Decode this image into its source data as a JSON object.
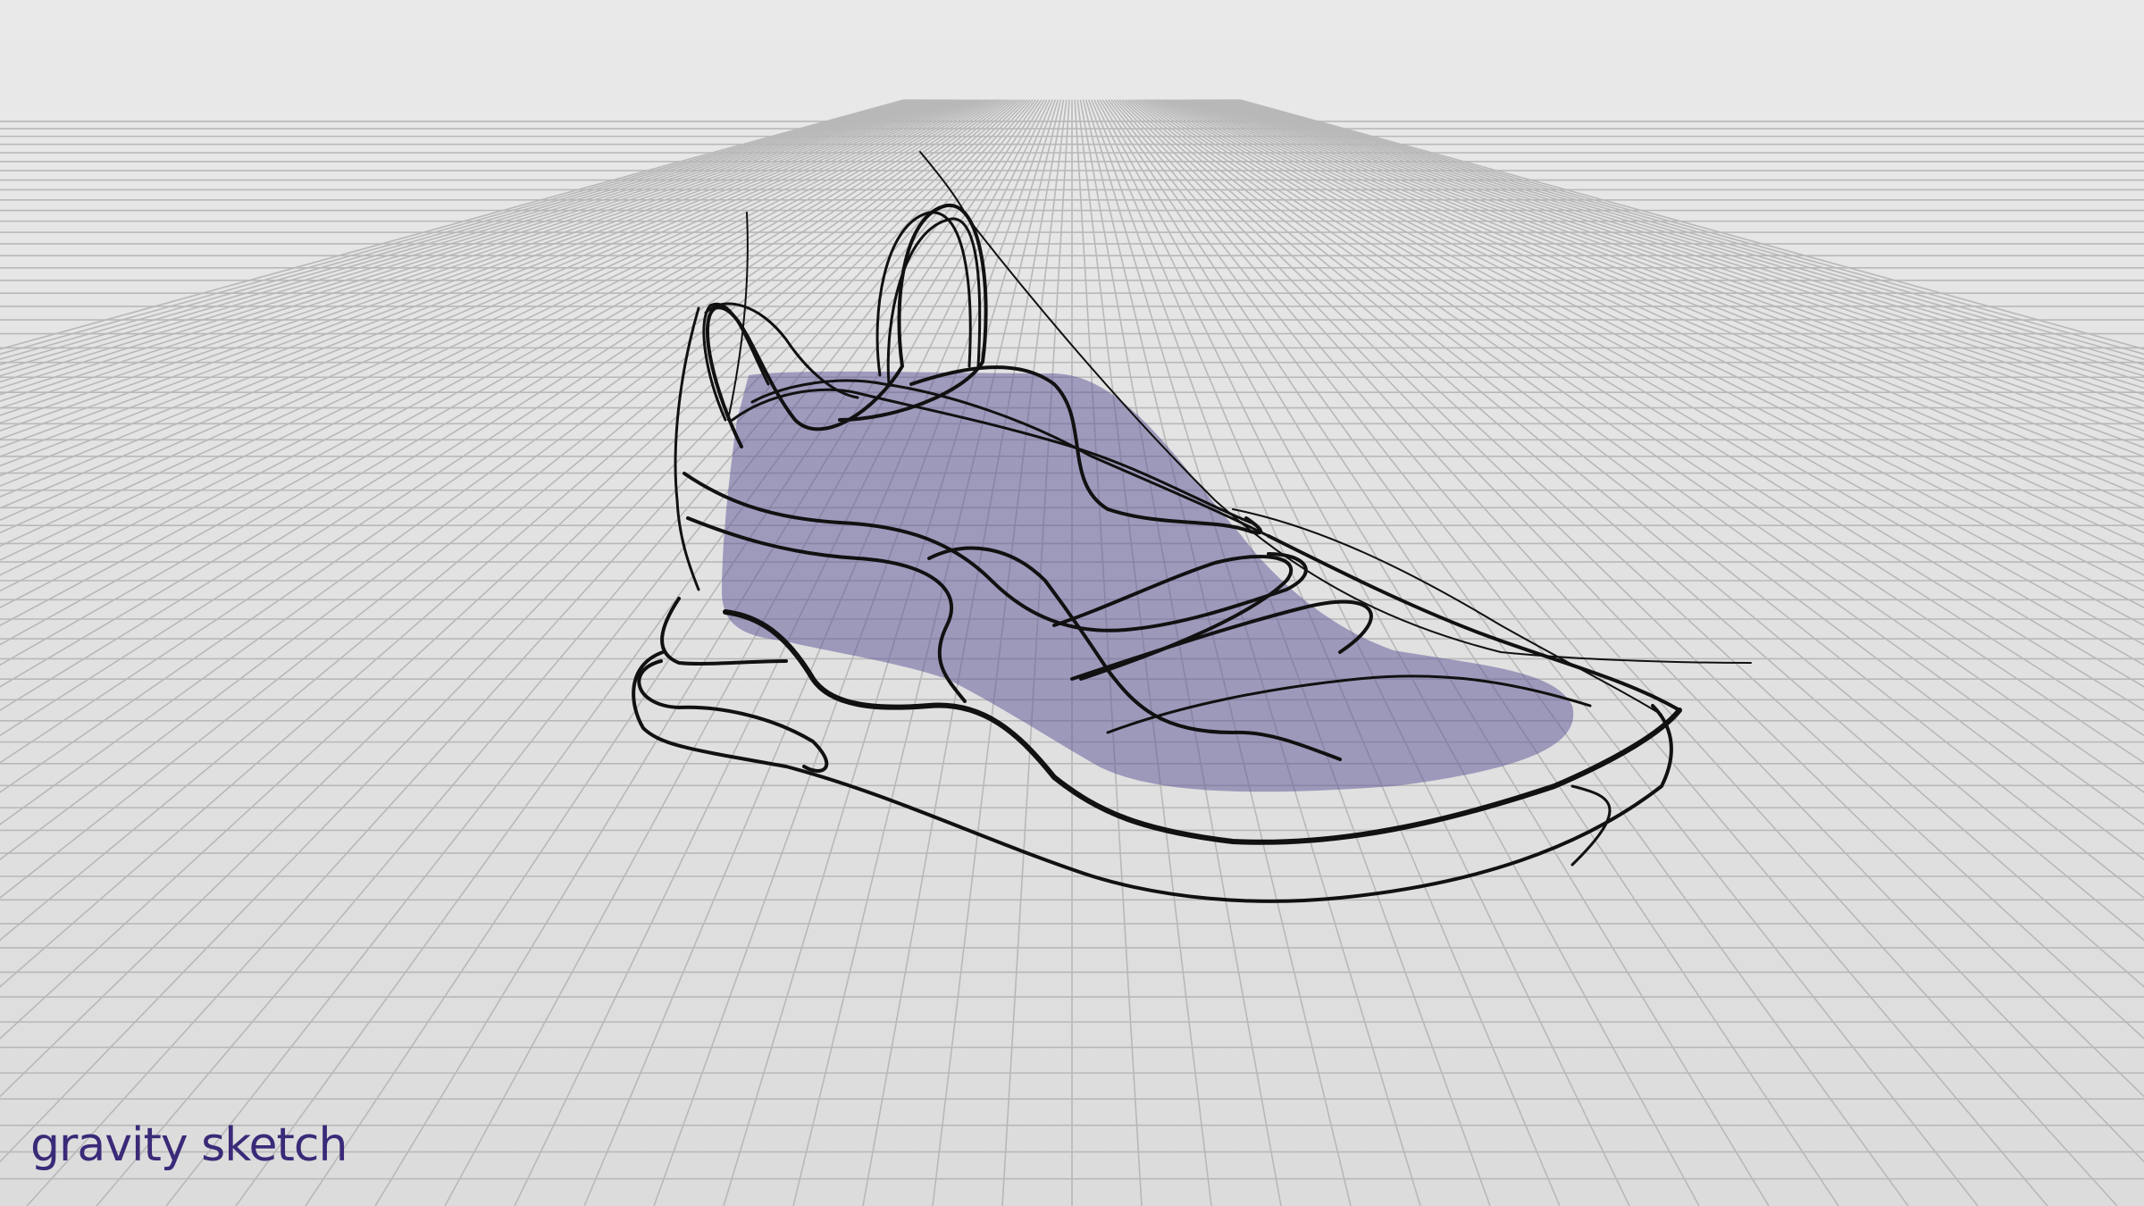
{
  "app": {
    "brand_label": "gravity sketch"
  },
  "icons": {
    "logo": "gravity-sketch-wordmark"
  },
  "colors": {
    "background": "#e4e4e4",
    "grid_line": "#b8b8b8",
    "stroke": "#111111",
    "surface_fill": "#5a5296",
    "brand": "#3a2a78"
  }
}
